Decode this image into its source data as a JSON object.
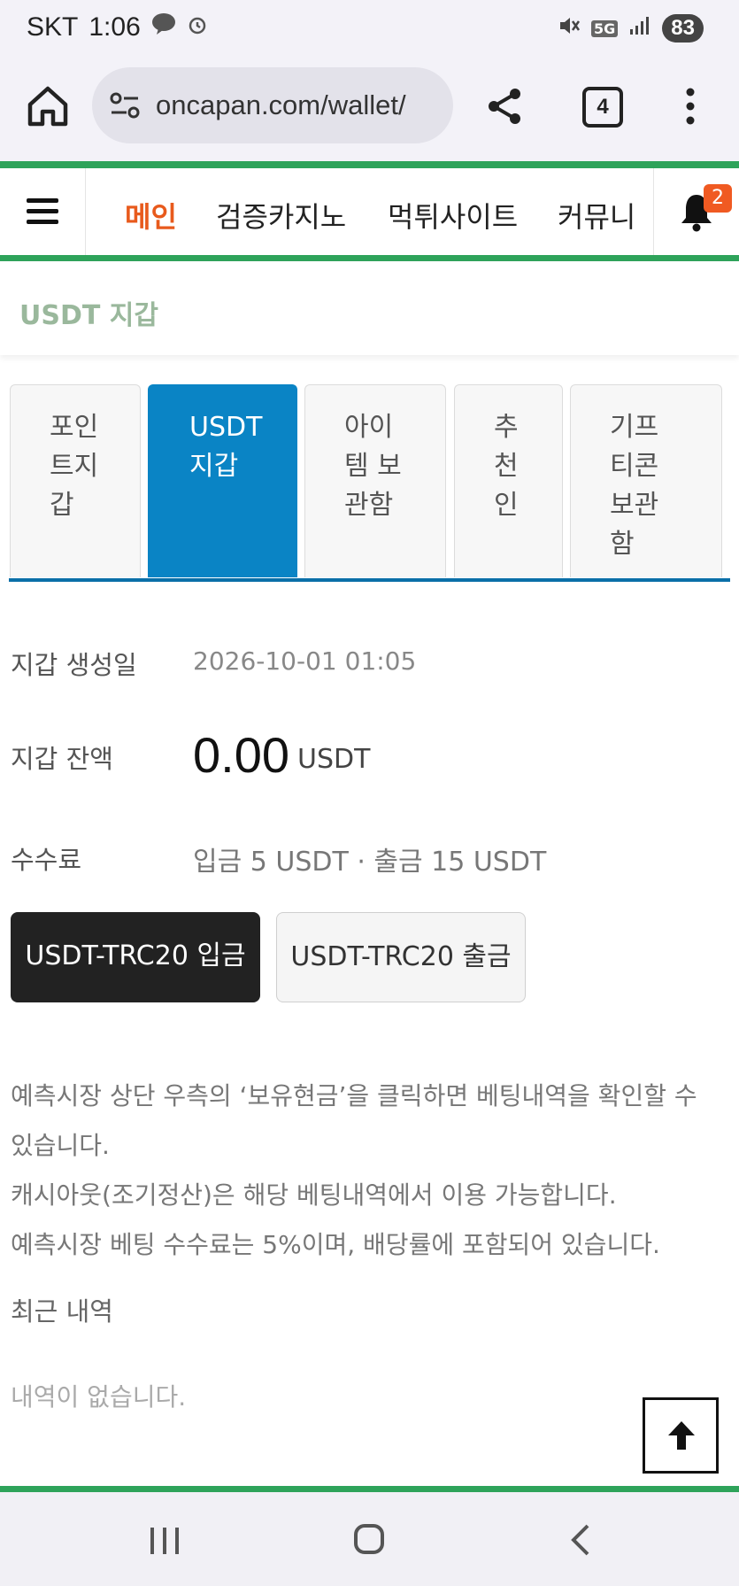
{
  "status": {
    "carrier": "SKT",
    "time": "1:06",
    "network": "5G",
    "battery": "83"
  },
  "browser": {
    "url": "oncapan.com/wallet/",
    "tab_count": "4"
  },
  "site_nav": {
    "items": [
      {
        "label": "메인",
        "active": true
      },
      {
        "label": "검증카지노",
        "active": false
      },
      {
        "label": "먹튀사이트",
        "active": false
      },
      {
        "label": "커뮤니",
        "active": false
      }
    ],
    "notification_count": "2"
  },
  "page": {
    "title": "USDT 지갑"
  },
  "tabs": [
    {
      "label": "포인트지갑",
      "active": false
    },
    {
      "label": "USDT 지갑",
      "active": true
    },
    {
      "label": "아이템 보관함",
      "active": false
    },
    {
      "label": "추천인",
      "active": false
    },
    {
      "label": "기프티콘보관함",
      "active": false
    }
  ],
  "wallet": {
    "created_label": "지갑 생성일",
    "created_value": "2026-10-01 01:05",
    "balance_label": "지갑 잔액",
    "balance_value": "0.00",
    "balance_unit": "USDT",
    "fee_label": "수수료",
    "fee_value": "입금 5 USDT · 출금 15 USDT"
  },
  "buttons": {
    "deposit": "USDT-TRC20 입금",
    "withdraw": "USDT-TRC20 출금"
  },
  "notes": {
    "line1": "예측시장 상단 우측의 ‘보유현금’을 클릭하면 베팅내역을 확인할 수 있습니다.",
    "line2": "캐시아웃(조기정산)은 해당 베팅내역에서 이용 가능합니다.",
    "line3": "예측시장 베팅 수수료는 5%이며, 배당률에 포함되어 있습니다."
  },
  "recent": {
    "label": "최근 내역",
    "empty": "내역이 없습니다."
  },
  "colors": {
    "accent_green": "#2ea35a",
    "tab_active": "#0a84c5",
    "nav_active": "#e85a1c",
    "badge": "#f05a22"
  }
}
